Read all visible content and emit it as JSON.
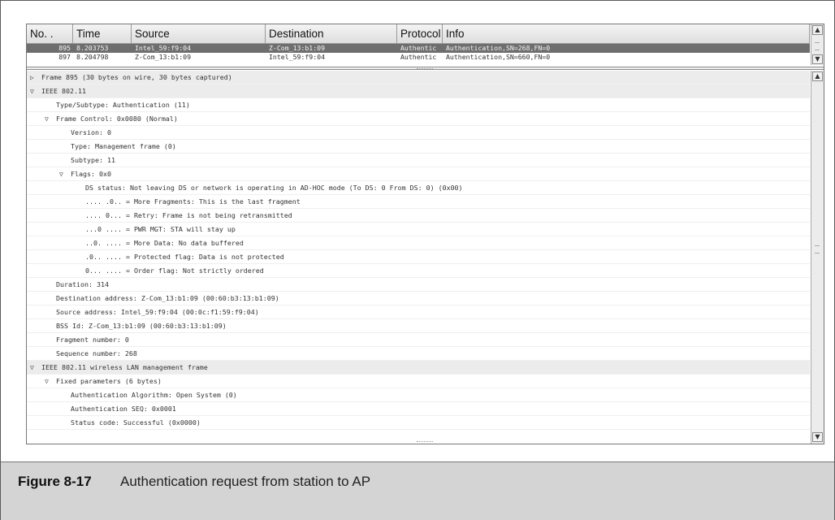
{
  "packet_list": {
    "columns": [
      "No. .",
      "Time",
      "Source",
      "Destination",
      "Protocol",
      "Info"
    ],
    "rows": [
      {
        "no": "895",
        "time": "8.203753",
        "source": "Intel_59:f9:04",
        "destination": "Z-Com_13:b1:09",
        "protocol": "Authentic",
        "info": "Authentication,SN=268,FN=0",
        "selected": true
      },
      {
        "no": "897",
        "time": "8.204798",
        "source": "Z-Com_13:b1:09",
        "destination": "Intel_59:f9:04",
        "protocol": "Authentic",
        "info": "Authentication,SN=660,FN=0",
        "selected": false
      }
    ]
  },
  "details": [
    {
      "text": "Frame 895 (30 bytes on wire, 30 bytes captured)",
      "level": 0,
      "toggle": "collapsed",
      "section": true
    },
    {
      "text": "IEEE 802.11",
      "level": 0,
      "toggle": "expanded",
      "section": true
    },
    {
      "text": "Type/Subtype: Authentication (11)",
      "level": 1,
      "toggle": "none"
    },
    {
      "text": "Frame Control: 0x0080 (Normal)",
      "level": 1,
      "toggle": "expanded"
    },
    {
      "text": "Version: 0",
      "level": 2,
      "toggle": "none"
    },
    {
      "text": "Type: Management frame (0)",
      "level": 2,
      "toggle": "none"
    },
    {
      "text": "Subtype: 11",
      "level": 2,
      "toggle": "none"
    },
    {
      "text": "Flags: 0x0",
      "level": 2,
      "toggle": "expanded"
    },
    {
      "text": "DS status: Not leaving DS or network is operating in AD-HOC mode (To DS: 0 From DS: 0) (0x00)",
      "level": 3,
      "toggle": "none"
    },
    {
      "text": ".... .0.. = More Fragments: This is the last fragment",
      "level": 3,
      "toggle": "none"
    },
    {
      "text": ".... 0... = Retry: Frame is not being retransmitted",
      "level": 3,
      "toggle": "none"
    },
    {
      "text": "...0 .... = PWR MGT: STA will stay up",
      "level": 3,
      "toggle": "none"
    },
    {
      "text": "..0. .... = More Data: No data buffered",
      "level": 3,
      "toggle": "none"
    },
    {
      "text": ".0.. .... = Protected flag: Data is not protected",
      "level": 3,
      "toggle": "none"
    },
    {
      "text": "0... .... = Order flag: Not strictly ordered",
      "level": 3,
      "toggle": "none"
    },
    {
      "text": "Duration: 314",
      "level": 1,
      "toggle": "none"
    },
    {
      "text": "Destination address: Z-Com_13:b1:09 (00:60:b3:13:b1:09)",
      "level": 1,
      "toggle": "none"
    },
    {
      "text": "Source address: Intel_59:f9:04 (00:0c:f1:59:f9:04)",
      "level": 1,
      "toggle": "none"
    },
    {
      "text": "BSS Id: Z-Com_13:b1:09 (00:60:b3:13:b1:09)",
      "level": 1,
      "toggle": "none"
    },
    {
      "text": "Fragment number: 0",
      "level": 1,
      "toggle": "none"
    },
    {
      "text": "Sequence number: 268",
      "level": 1,
      "toggle": "none"
    },
    {
      "text": "IEEE 802.11 wireless LAN management frame",
      "level": 0,
      "toggle": "expanded",
      "section": true
    },
    {
      "text": "Fixed parameters (6 bytes)",
      "level": 1,
      "toggle": "expanded"
    },
    {
      "text": "Authentication Algorithm: Open System (0)",
      "level": 2,
      "toggle": "none"
    },
    {
      "text": "Authentication SEQ: 0x0001",
      "level": 2,
      "toggle": "none"
    },
    {
      "text": "Status code: Successful (0x0000)",
      "level": 2,
      "toggle": "none"
    }
  ],
  "icons": {
    "collapsed": "▷",
    "expanded": "▽",
    "scroll_up": "▲",
    "scroll_down": "▼"
  },
  "caption": {
    "number": "Figure 8-17",
    "text": "Authentication request from station to AP"
  }
}
